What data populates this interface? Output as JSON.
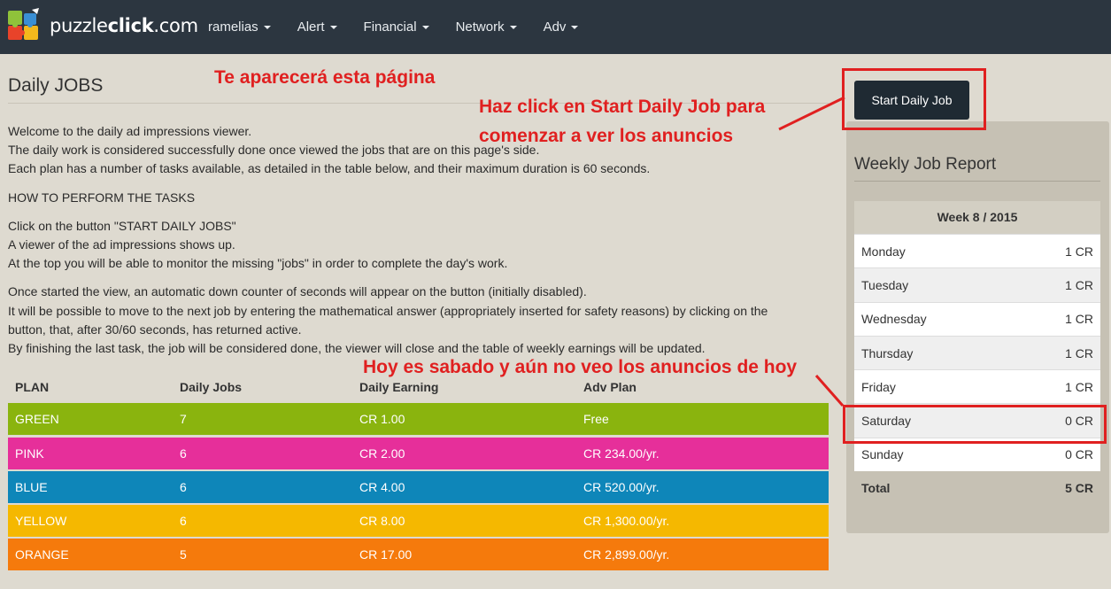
{
  "navbar": {
    "brand_light": "puzzle",
    "brand_strong": "click",
    "brand_suffix": ".com",
    "menu": [
      {
        "label": "ramelias"
      },
      {
        "label": "Alert"
      },
      {
        "label": "Financial"
      },
      {
        "label": "Network"
      },
      {
        "label": "Adv"
      }
    ]
  },
  "main": {
    "title": "Daily JOBS",
    "paragraphs": [
      "Welcome to the daily ad impressions viewer.",
      "The daily work is considered successfully done once viewed the jobs that are on this page's side.",
      "Each plan has a number of tasks available, as detailed in the table below, and their maximum duration is 60 seconds.",
      "HOW TO PERFORM THE TASKS",
      "Click on the button \"START DAILY JOBS\"",
      "A viewer of the ad impressions shows up.",
      "At the top you will be able to monitor the  missing \"jobs\" in order to complete the day's work.",
      "Once started the view, an  automatic down counter of  seconds will appear on the button (initially disabled).",
      "It will be possible to move to the next job by entering the mathematical answer (appropriately inserted for safety reasons) by clicking on the",
      "button, that, after 30/60 seconds, has returned active.",
      "By finishing the last task, the job will be considered done, the viewer will close and  the table of weekly earnings will be updated."
    ]
  },
  "plans": {
    "headers": [
      "PLAN",
      "Daily Jobs",
      "Daily Earning",
      "Adv Plan"
    ],
    "rows": [
      {
        "plan": "GREEN",
        "jobs": "7",
        "earning": "CR 1.00",
        "adv": "Free",
        "color": "#8ab40e"
      },
      {
        "plan": "PINK",
        "jobs": "6",
        "earning": "CR 2.00",
        "adv": "CR 234.00/yr.",
        "color": "#e62f9a"
      },
      {
        "plan": "BLUE",
        "jobs": "6",
        "earning": "CR 4.00",
        "adv": "CR 520.00/yr.",
        "color": "#0e86b9"
      },
      {
        "plan": "YELLOW",
        "jobs": "6",
        "earning": "CR 8.00",
        "adv": "CR 1,300.00/yr.",
        "color": "#f5b800"
      },
      {
        "plan": "ORANGE",
        "jobs": "5",
        "earning": "CR 17.00",
        "adv": "CR 2,899.00/yr.",
        "color": "#f57a0c"
      }
    ]
  },
  "sidebar": {
    "start_button": "Start Daily Job",
    "report_title": "Weekly Job Report",
    "week": "Week 8 / 2015",
    "days": [
      {
        "day": "Monday",
        "value": "1 CR"
      },
      {
        "day": "Tuesday",
        "value": "1 CR"
      },
      {
        "day": "Wednesday",
        "value": "1 CR"
      },
      {
        "day": "Thursday",
        "value": "1 CR"
      },
      {
        "day": "Friday",
        "value": "1 CR"
      },
      {
        "day": "Saturday",
        "value": "0 CR"
      },
      {
        "day": "Sunday",
        "value": "0 CR"
      }
    ],
    "total_label": "Total",
    "total_value": "5 CR"
  },
  "annotations": {
    "page_note": "Te aparecerá esta página",
    "click_note_line1": "Haz click en Start Daily Job para",
    "click_note_line2": "comenzar a ver los anuncios",
    "saturday_note": "Hoy es sabado y aún no veo los anuncios de hoy",
    "color": "#e02020"
  },
  "colors": {
    "navbar": "#2c3640",
    "background": "#dedad0",
    "button": "#1f2a33"
  }
}
